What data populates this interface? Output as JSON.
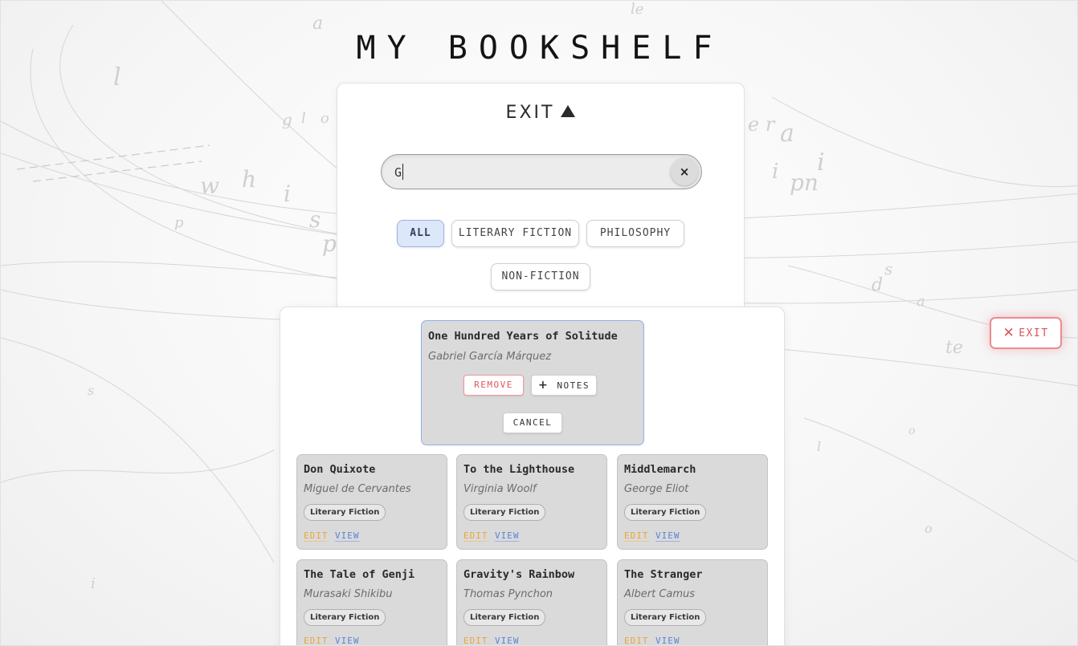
{
  "app": {
    "title": "MY BOOKSHELF"
  },
  "top_panel": {
    "exit_label": "EXIT",
    "search": {
      "value": "G",
      "clear_icon": "×"
    },
    "filters": [
      {
        "label": "ALL",
        "active": true
      },
      {
        "label": "LITERARY FICTION",
        "active": false
      },
      {
        "label": "PHILOSOPHY",
        "active": false
      },
      {
        "label": "NON-FICTION",
        "active": false
      }
    ]
  },
  "selected_book": {
    "title": "One Hundred Years of Solitude",
    "author": "Gabriel García Márquez",
    "remove_label": "REMOVE",
    "notes_label": "NOTES",
    "notes_icon": "+",
    "cancel_label": "CANCEL"
  },
  "books": [
    {
      "title": "Don Quixote",
      "author": "Miguel de Cervantes",
      "genre": "Literary Fiction",
      "edit_label": "EDIT",
      "view_label": "VIEW"
    },
    {
      "title": "To the Lighthouse",
      "author": "Virginia Woolf",
      "genre": "Literary Fiction",
      "edit_label": "EDIT",
      "view_label": "VIEW"
    },
    {
      "title": "Middlemarch",
      "author": "George Eliot",
      "genre": "Literary Fiction",
      "edit_label": "EDIT",
      "view_label": "VIEW"
    },
    {
      "title": "The Tale of Genji",
      "author": "Murasaki Shikibu",
      "genre": "Literary Fiction",
      "edit_label": "EDIT",
      "view_label": "VIEW"
    },
    {
      "title": "Gravity's Rainbow",
      "author": "Thomas Pynchon",
      "genre": "Literary Fiction",
      "edit_label": "EDIT",
      "view_label": "VIEW"
    },
    {
      "title": "The Stranger",
      "author": "Albert Camus",
      "genre": "Literary Fiction",
      "edit_label": "EDIT",
      "view_label": "VIEW"
    }
  ],
  "float_exit": {
    "label": "EXIT",
    "icon": "✕"
  },
  "colors": {
    "accent_active": "#dce7fa",
    "remove_red": "#e0565b",
    "edit_orange": "#e8a73c",
    "view_blue": "#5b83d6",
    "exit_red": "#d9555b"
  }
}
